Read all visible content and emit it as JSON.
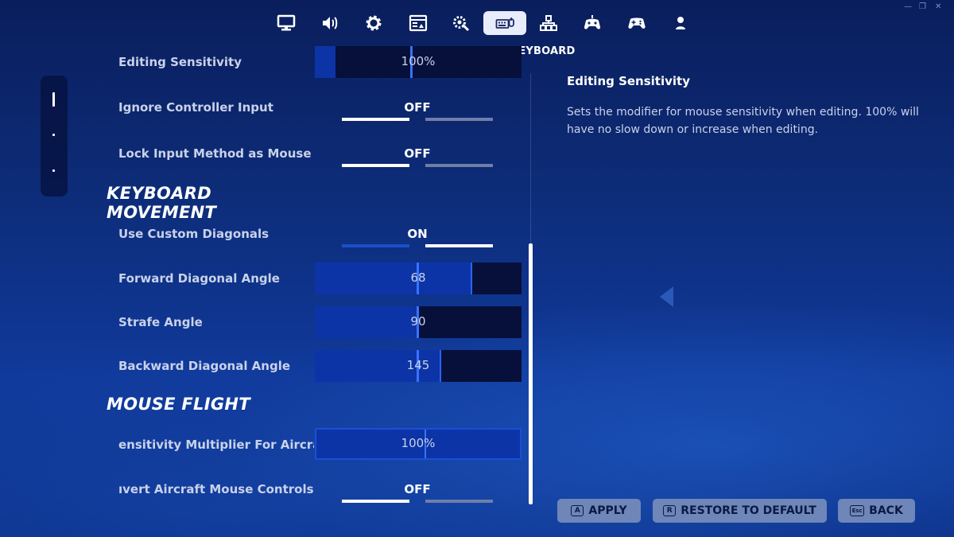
{
  "window_controls": {
    "minimize": "—",
    "restore": "❐",
    "close": "✕"
  },
  "nav": {
    "icons": [
      "display-icon",
      "audio-icon",
      "gear-icon",
      "video-settings-icon",
      "accessibility-icon",
      "keyboard-mouse-icon",
      "hierarchy-icon",
      "controller-touch-icon",
      "gamepad-icon",
      "account-icon"
    ],
    "active_index": 5,
    "active_title": "MOUSE AND KEYBOARD"
  },
  "settings": {
    "editing_sensitivity": {
      "label": "Editing Sensitivity",
      "value": "100%",
      "fill_fraction": 0.1
    },
    "ignore_controller_input": {
      "label": "Ignore Controller Input",
      "value": "OFF"
    },
    "lock_input_method": {
      "label": "Lock Input Method as Mouse",
      "value": "OFF"
    },
    "section_keyboard_movement": "KEYBOARD MOVEMENT",
    "use_custom_diagonals": {
      "label": "Use Custom Diagonals",
      "value": "ON"
    },
    "forward_diagonal_angle": {
      "label": "Forward Diagonal Angle",
      "value": "68",
      "fill_fraction": 0.76
    },
    "strafe_angle": {
      "label": "Strafe Angle",
      "value": "90",
      "fill_fraction": 0.5
    },
    "backward_diagonal_angle": {
      "label": "Backward Diagonal Angle",
      "value": "145",
      "fill_fraction": 0.61
    },
    "section_mouse_flight": "MOUSE FLIGHT",
    "aircraft_sensitivity": {
      "label": "ensitivity Multiplier For Aircra",
      "value": "100%",
      "fill_fraction": 1.0
    },
    "invert_aircraft": {
      "label": "ıvert Aircraft Mouse Controls",
      "value": "OFF"
    }
  },
  "detail": {
    "title": "Editing Sensitivity",
    "description": "Sets the modifier for mouse sensitivity when editing. 100% will have no slow down or increase when editing."
  },
  "buttons": {
    "apply": {
      "key": "A",
      "label": "APPLY"
    },
    "restore": {
      "key": "R",
      "label": "RESTORE TO DEFAULT"
    },
    "back": {
      "key": "Esc",
      "label": "BACK"
    }
  }
}
